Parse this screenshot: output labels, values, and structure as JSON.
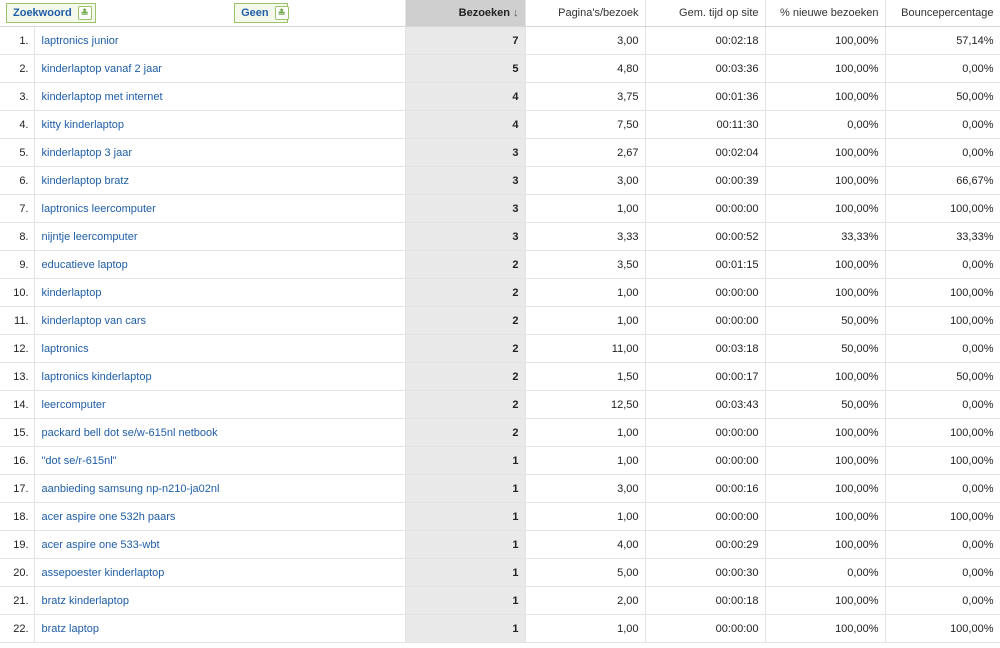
{
  "header": {
    "primary_dimension": "Zoekwoord",
    "secondary_dimension": "Geen",
    "col_visits": "Bezoeken",
    "col_pages": "Pagina's/bezoek",
    "col_time": "Gem. tijd op site",
    "col_new": "% nieuwe bezoeken",
    "col_bounce": "Bouncepercentage",
    "sort_indicator": "↓"
  },
  "rows": [
    {
      "idx": "1.",
      "keyword": "laptronics junior",
      "visits": "7",
      "pages": "3,00",
      "time": "00:02:18",
      "new": "100,00%",
      "bounce": "57,14%"
    },
    {
      "idx": "2.",
      "keyword": "kinderlaptop vanaf 2 jaar",
      "visits": "5",
      "pages": "4,80",
      "time": "00:03:36",
      "new": "100,00%",
      "bounce": "0,00%"
    },
    {
      "idx": "3.",
      "keyword": "kinderlaptop met internet",
      "visits": "4",
      "pages": "3,75",
      "time": "00:01:36",
      "new": "100,00%",
      "bounce": "50,00%"
    },
    {
      "idx": "4.",
      "keyword": "kitty kinderlaptop",
      "visits": "4",
      "pages": "7,50",
      "time": "00:11:30",
      "new": "0,00%",
      "bounce": "0,00%"
    },
    {
      "idx": "5.",
      "keyword": "kinderlaptop 3 jaar",
      "visits": "3",
      "pages": "2,67",
      "time": "00:02:04",
      "new": "100,00%",
      "bounce": "0,00%"
    },
    {
      "idx": "6.",
      "keyword": "kinderlaptop bratz",
      "visits": "3",
      "pages": "3,00",
      "time": "00:00:39",
      "new": "100,00%",
      "bounce": "66,67%"
    },
    {
      "idx": "7.",
      "keyword": "laptronics leercomputer",
      "visits": "3",
      "pages": "1,00",
      "time": "00:00:00",
      "new": "100,00%",
      "bounce": "100,00%"
    },
    {
      "idx": "8.",
      "keyword": "nijntje leercomputer",
      "visits": "3",
      "pages": "3,33",
      "time": "00:00:52",
      "new": "33,33%",
      "bounce": "33,33%"
    },
    {
      "idx": "9.",
      "keyword": "educatieve laptop",
      "visits": "2",
      "pages": "3,50",
      "time": "00:01:15",
      "new": "100,00%",
      "bounce": "0,00%"
    },
    {
      "idx": "10.",
      "keyword": "kinderlaptop",
      "visits": "2",
      "pages": "1,00",
      "time": "00:00:00",
      "new": "100,00%",
      "bounce": "100,00%"
    },
    {
      "idx": "11.",
      "keyword": "kinderlaptop van cars",
      "visits": "2",
      "pages": "1,00",
      "time": "00:00:00",
      "new": "50,00%",
      "bounce": "100,00%"
    },
    {
      "idx": "12.",
      "keyword": "laptronics",
      "visits": "2",
      "pages": "11,00",
      "time": "00:03:18",
      "new": "50,00%",
      "bounce": "0,00%"
    },
    {
      "idx": "13.",
      "keyword": "laptronics kinderlaptop",
      "visits": "2",
      "pages": "1,50",
      "time": "00:00:17",
      "new": "100,00%",
      "bounce": "50,00%"
    },
    {
      "idx": "14.",
      "keyword": "leercomputer",
      "visits": "2",
      "pages": "12,50",
      "time": "00:03:43",
      "new": "50,00%",
      "bounce": "0,00%"
    },
    {
      "idx": "15.",
      "keyword": "packard bell dot se/w-615nl netbook",
      "visits": "2",
      "pages": "1,00",
      "time": "00:00:00",
      "new": "100,00%",
      "bounce": "100,00%"
    },
    {
      "idx": "16.",
      "keyword": "\"dot se/r-615nl\"",
      "visits": "1",
      "pages": "1,00",
      "time": "00:00:00",
      "new": "100,00%",
      "bounce": "100,00%"
    },
    {
      "idx": "17.",
      "keyword": "aanbieding samsung np-n210-ja02nl",
      "visits": "1",
      "pages": "3,00",
      "time": "00:00:16",
      "new": "100,00%",
      "bounce": "0,00%"
    },
    {
      "idx": "18.",
      "keyword": "acer aspire one 532h paars",
      "visits": "1",
      "pages": "1,00",
      "time": "00:00:00",
      "new": "100,00%",
      "bounce": "100,00%"
    },
    {
      "idx": "19.",
      "keyword": "acer aspire one 533-wbt",
      "visits": "1",
      "pages": "4,00",
      "time": "00:00:29",
      "new": "100,00%",
      "bounce": "0,00%"
    },
    {
      "idx": "20.",
      "keyword": "assepoester kinderlaptop",
      "visits": "1",
      "pages": "5,00",
      "time": "00:00:30",
      "new": "0,00%",
      "bounce": "0,00%"
    },
    {
      "idx": "21.",
      "keyword": "bratz kinderlaptop",
      "visits": "1",
      "pages": "2,00",
      "time": "00:00:18",
      "new": "100,00%",
      "bounce": "0,00%"
    },
    {
      "idx": "22.",
      "keyword": "bratz laptop",
      "visits": "1",
      "pages": "1,00",
      "time": "00:00:00",
      "new": "100,00%",
      "bounce": "100,00%"
    }
  ],
  "colors": {
    "link": "#1f5ea8",
    "sorted_column": "#e9e9e9",
    "sorted_header": "#cfcfcf",
    "dropdown_border": "#9cc36c"
  }
}
